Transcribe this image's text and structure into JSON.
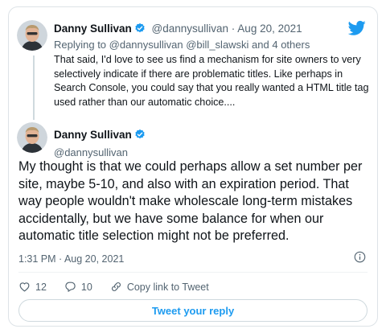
{
  "parent": {
    "name": "Danny Sullivan",
    "handle_date": "@dannysullivan · Aug 20, 2021",
    "replying_to": "Replying to @dannysullivan @bill_slawski and 4 others",
    "text": "That said, I'd love to see us find a mechanism for site owners to very selectively indicate if there are problematic titles. Like perhaps in Search Console, you could say that you really wanted a HTML title tag used rather than our automatic choice...."
  },
  "tweet": {
    "name": "Danny Sullivan",
    "handle": "@dannysullivan",
    "text": "My thought is that we could perhaps allow a set number per site, maybe 5-10, and also with an expiration period. That way people wouldn't make wholescale long-term mistakes accidentally, but we have some balance for when our automatic title selection might not be preferred.",
    "timestamp": "1:31 PM · Aug 20, 2021"
  },
  "actions": {
    "likes": "12",
    "replies": "10",
    "copy_link": "Copy link to Tweet"
  },
  "reply_button": "Tweet your reply",
  "icons": {
    "brand": "twitter-bird-icon",
    "verified": "verified-badge-icon",
    "like": "heart-icon",
    "reply": "reply-bubble-icon",
    "link": "link-icon",
    "info": "info-icon"
  },
  "colors": {
    "accent": "#1d9bf0",
    "text": "#0f1419",
    "muted": "#536471",
    "border": "#dde3e7"
  }
}
